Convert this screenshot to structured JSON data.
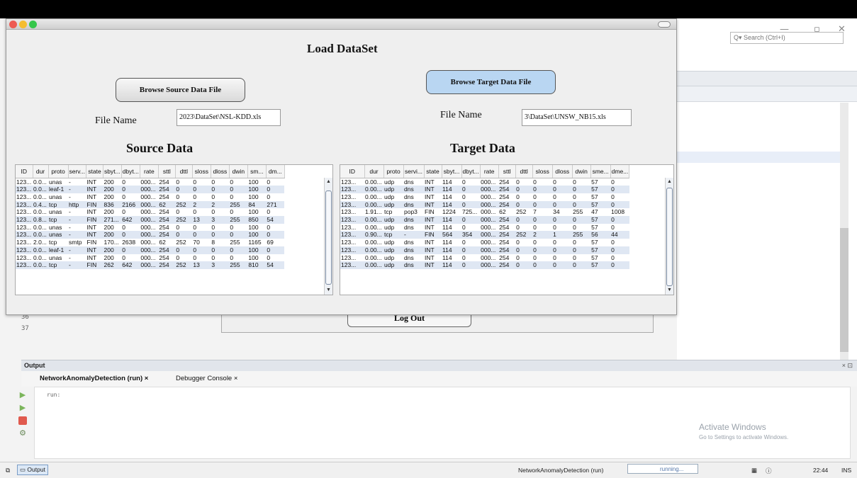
{
  "frame": {
    "title": "Load DataSet"
  },
  "source": {
    "browse_label": "Browse Source Data File",
    "file_label": "File Name",
    "file_value": "2023\\DataSet\\NSL-KDD.xls",
    "heading": "Source Data",
    "columns": [
      "ID",
      "dur",
      "proto",
      "serv...",
      "state",
      "sbyt...",
      "dbyt...",
      "rate",
      "sttl",
      "dttl",
      "sloss",
      "dloss",
      "dwin",
      "sm...",
      "dm..."
    ],
    "rows": [
      [
        "123...",
        "0.0...",
        "unas",
        "-",
        "INT",
        "200",
        "0",
        "000...",
        "254",
        "0",
        "0",
        "0",
        "0",
        "100",
        "0"
      ],
      [
        "123...",
        "0.0...",
        "leaf-1",
        "-",
        "INT",
        "200",
        "0",
        "000...",
        "254",
        "0",
        "0",
        "0",
        "0",
        "100",
        "0"
      ],
      [
        "123...",
        "0.0...",
        "unas",
        "-",
        "INT",
        "200",
        "0",
        "000...",
        "254",
        "0",
        "0",
        "0",
        "0",
        "100",
        "0"
      ],
      [
        "123...",
        "0.4...",
        "tcp",
        "http",
        "FIN",
        "836",
        "2166",
        "000...",
        "62",
        "252",
        "2",
        "2",
        "255",
        "84",
        "271"
      ],
      [
        "123...",
        "0.0...",
        "unas",
        "-",
        "INT",
        "200",
        "0",
        "000...",
        "254",
        "0",
        "0",
        "0",
        "0",
        "100",
        "0"
      ],
      [
        "123...",
        "0.8...",
        "tcp",
        "-",
        "FIN",
        "271...",
        "642",
        "000...",
        "254",
        "252",
        "13",
        "3",
        "255",
        "850",
        "54"
      ],
      [
        "123...",
        "0.0...",
        "unas",
        "-",
        "INT",
        "200",
        "0",
        "000...",
        "254",
        "0",
        "0",
        "0",
        "0",
        "100",
        "0"
      ],
      [
        "123...",
        "0.0...",
        "unas",
        "-",
        "INT",
        "200",
        "0",
        "000...",
        "254",
        "0",
        "0",
        "0",
        "0",
        "100",
        "0"
      ],
      [
        "123...",
        "2.0...",
        "tcp",
        "smtp",
        "FIN",
        "170...",
        "2638",
        "000...",
        "62",
        "252",
        "70",
        "8",
        "255",
        "1165",
        "69"
      ],
      [
        "123...",
        "0.0...",
        "leaf-1",
        "-",
        "INT",
        "200",
        "0",
        "000...",
        "254",
        "0",
        "0",
        "0",
        "0",
        "100",
        "0"
      ],
      [
        "123...",
        "0.0...",
        "unas",
        "-",
        "INT",
        "200",
        "0",
        "000...",
        "254",
        "0",
        "0",
        "0",
        "0",
        "100",
        "0"
      ],
      [
        "123...",
        "0.0...",
        "tcp",
        "-",
        "FIN",
        "262",
        "642",
        "000...",
        "254",
        "252",
        "13",
        "3",
        "255",
        "810",
        "54"
      ]
    ]
  },
  "target": {
    "browse_label": "Browse Target Data File",
    "file_label": "File Name",
    "file_value": "3\\DataSet\\UNSW_NB15.xls",
    "heading": "Target Data",
    "columns": [
      "ID",
      "dur",
      "proto",
      "servi...",
      "state",
      "sbyt...",
      "dbyt...",
      "rate",
      "sttl",
      "dttl",
      "sloss",
      "dloss",
      "dwin",
      "sme...",
      "dme..."
    ],
    "rows": [
      [
        "123...",
        "0.00...",
        "udp",
        "dns",
        "INT",
        "114",
        "0",
        "000...",
        "254",
        "0",
        "0",
        "0",
        "0",
        "57",
        "0"
      ],
      [
        "123...",
        "0.00...",
        "udp",
        "dns",
        "INT",
        "114",
        "0",
        "000...",
        "254",
        "0",
        "0",
        "0",
        "0",
        "57",
        "0"
      ],
      [
        "123...",
        "0.00...",
        "udp",
        "dns",
        "INT",
        "114",
        "0",
        "000...",
        "254",
        "0",
        "0",
        "0",
        "0",
        "57",
        "0"
      ],
      [
        "123...",
        "0.00...",
        "udp",
        "dns",
        "INT",
        "114",
        "0",
        "000...",
        "254",
        "0",
        "0",
        "0",
        "0",
        "57",
        "0"
      ],
      [
        "123...",
        "1.91...",
        "tcp",
        "pop3",
        "FIN",
        "1224",
        "725...",
        "000...",
        "62",
        "252",
        "7",
        "34",
        "255",
        "47",
        "1008"
      ],
      [
        "123...",
        "0.00...",
        "udp",
        "dns",
        "INT",
        "114",
        "0",
        "000...",
        "254",
        "0",
        "0",
        "0",
        "0",
        "57",
        "0"
      ],
      [
        "123...",
        "0.00...",
        "udp",
        "dns",
        "INT",
        "114",
        "0",
        "000...",
        "254",
        "0",
        "0",
        "0",
        "0",
        "57",
        "0"
      ],
      [
        "123...",
        "0.90...",
        "tcp",
        "-",
        "FIN",
        "564",
        "354",
        "000...",
        "254",
        "252",
        "2",
        "1",
        "255",
        "56",
        "44"
      ],
      [
        "123...",
        "0.00...",
        "udp",
        "dns",
        "INT",
        "114",
        "0",
        "000...",
        "254",
        "0",
        "0",
        "0",
        "0",
        "57",
        "0"
      ],
      [
        "123...",
        "0.00...",
        "udp",
        "dns",
        "INT",
        "114",
        "0",
        "000...",
        "254",
        "0",
        "0",
        "0",
        "0",
        "57",
        "0"
      ],
      [
        "123...",
        "0.00...",
        "udp",
        "dns",
        "INT",
        "114",
        "0",
        "000...",
        "254",
        "0",
        "0",
        "0",
        "0",
        "57",
        "0"
      ],
      [
        "123...",
        "0.00...",
        "udp",
        "dns",
        "INT",
        "114",
        "0",
        "000...",
        "254",
        "0",
        "0",
        "0",
        "0",
        "57",
        "0"
      ]
    ]
  },
  "logout_label": "Log Out",
  "ide": {
    "search_placeholder": "Search (Ctrl+I)",
    "line_numbers": [
      "36",
      "37"
    ],
    "output_title": "Output",
    "output_close": "× ⊡",
    "output_tabs": [
      "NetworkAnomalyDetection (run)",
      "Debugger Console"
    ],
    "tab_close": "×",
    "run_text": "run:",
    "watermark_title": "Activate Windows",
    "watermark_sub": "Go to Settings to activate Windows.",
    "status_output": "Output",
    "status_project": "NetworkAnomalyDetection (run)",
    "status_running": "running...",
    "status_time": "22:44",
    "status_ins": "INS"
  },
  "colors": {
    "close": "#ee5a52",
    "minimize": "#f5bd2f",
    "zoom": "#35c64a",
    "target_button": "#b9d6f2",
    "stripe": "#dfe7f3"
  }
}
